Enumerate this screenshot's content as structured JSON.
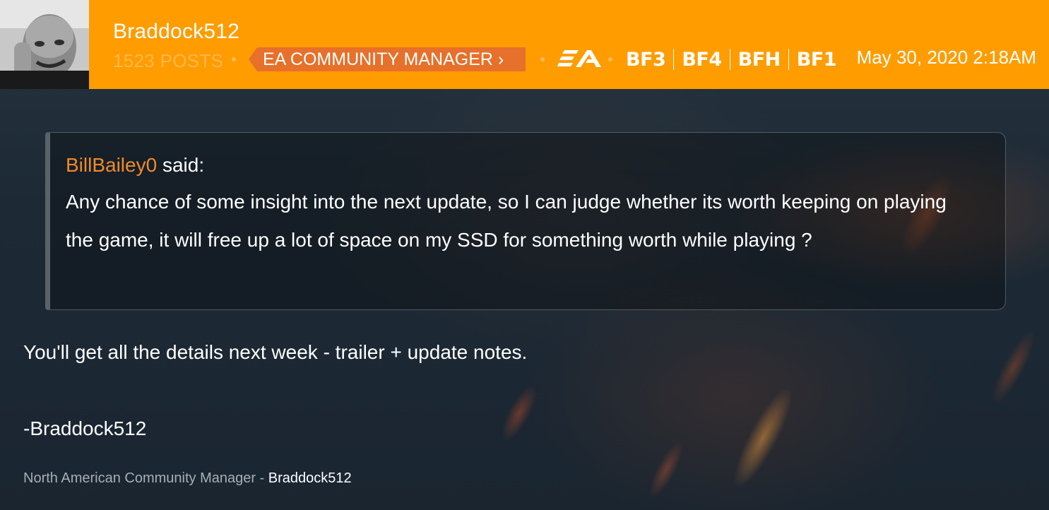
{
  "header": {
    "username": "Braddock512",
    "post_count": "1523 POSTS",
    "role_badge": "EA COMMUNITY MANAGER ›",
    "games": [
      "BF3",
      "BF4",
      "BFH",
      "BF1"
    ],
    "date": "May 30, 2020 2:18AM",
    "colors": {
      "header_bg": "#ff9c00",
      "badge_bg": "#e7702a",
      "quote_author": "#ee8a2c"
    },
    "icons": {
      "publisher": "ea-logo-icon",
      "avatar": "avatar-photo"
    }
  },
  "quote": {
    "author": "BillBailey0",
    "said_label": "said:",
    "text": "Any chance of some insight into the next update, so I can judge whether its worth keeping on playing the game, it will free up a lot of space on my SSD for something worth while playing ?"
  },
  "post": {
    "body": "You'll get all the details next week - trailer + update notes.",
    "signoff": "-Braddock512"
  },
  "signature": {
    "title": "North American Community Manager - ",
    "name": "Braddock512"
  }
}
